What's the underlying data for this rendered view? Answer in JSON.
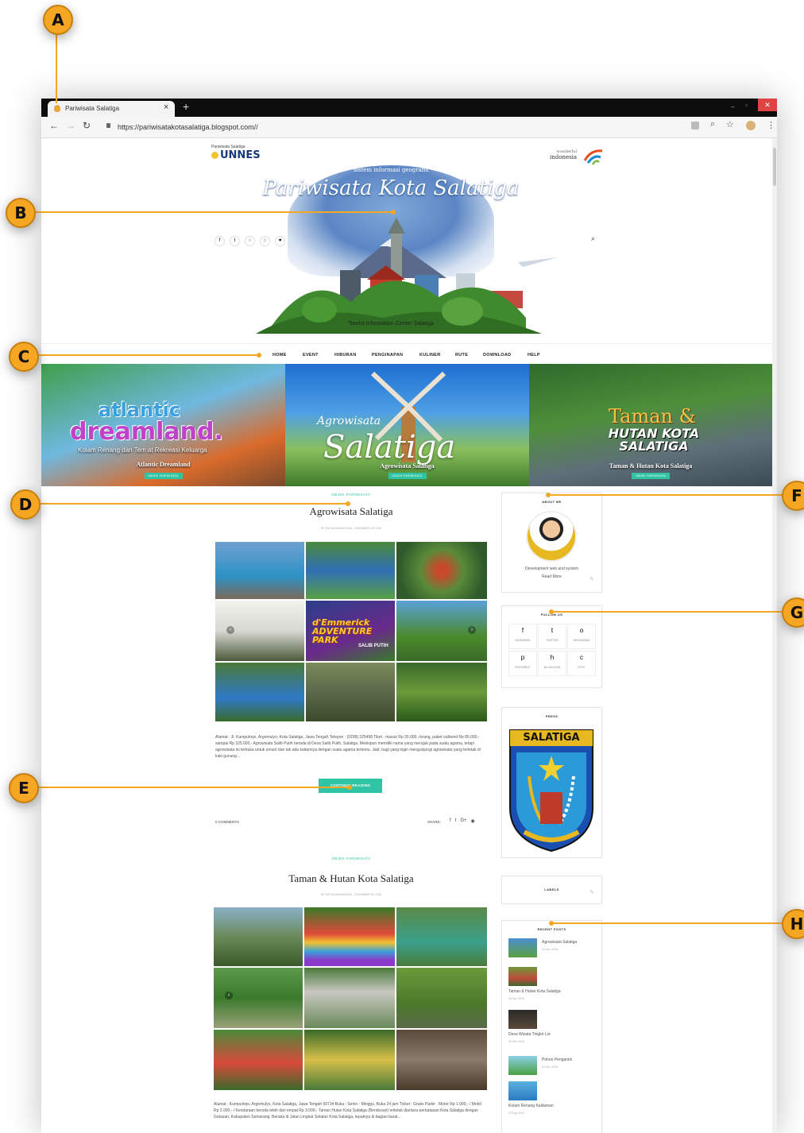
{
  "callouts": {
    "a": "A",
    "b": "B",
    "c": "C",
    "d": "D",
    "e": "E",
    "f": "F",
    "g": "G",
    "h": "H"
  },
  "browser": {
    "tab_title": "Pariwisata Salatiga",
    "tab_close": "×",
    "new_tab": "+",
    "url": "https://pariwisatakotasalatiga.blogspot.com//"
  },
  "header": {
    "logo_small": "Pariwisata Salatiga",
    "logo_big": "UNNES",
    "wi_top": "wonderful",
    "wi_bottom": "indonesia",
    "subtitle": "sistem informasi geografis",
    "title": "Pariwisata Kota Salatiga",
    "footer": "Tourist Information Center Salatiga"
  },
  "nav": [
    "HOME",
    "EVENT",
    "HIBURAN",
    "PENGINAPAN",
    "KULINER",
    "RUTE",
    "DOWNLOAD",
    "HELP"
  ],
  "slides": [
    {
      "art1": "atlantic",
      "art2": "dreamland.",
      "sub": "Kolam Renang dan Tem    at Rekreasi Keluarga",
      "caption": "Atlantic Dreamland",
      "tag": "OBJEK PARIWISATA"
    },
    {
      "art1": "Agrowisata",
      "art2": "Salatiga",
      "caption": "Agrowisata Salatiga",
      "tag": "OBJEK PARIWISATA"
    },
    {
      "art1": "Taman &",
      "art2": "HUTAN KOTA SALATIGA",
      "caption": "Taman & Hutan Kota Salatiga",
      "tag": "OBJEK PARIWISATA"
    }
  ],
  "post1": {
    "category": "OBJEK PARIWISATA",
    "title": "Agrowisata Salatiga",
    "meta": "BY RACHA MAHARDIKA - DESEMBER 05, 2018",
    "collage_text": "d'Emmerick ADVENTURE PARK",
    "collage_text2": "SALIB PUTIH",
    "excerpt": "Alamat : Jl. Kumpulrejo, Argomulyo, Kota Salatiga, Jawa Tengah  Telepon : (0298) 325498 Tiket : masuk Rp 30.000,-/orang, paket outbond Rp 85.000,- sampai Rp 325.000,- Agrowisata Salib Putih berada di Desa Salib Putih, Salatiga. Meskipun memiliki nama yang merujuk pada suatu agama, tetapi agrowisata ini terbuka untuk umum dan tak ada kaitannya dengan suatu agama tertentu. Jadi, bagi yang ingin mengunjungi agrowisata yang terletak di kaki gunung...",
    "button": "CONTINUE READING",
    "comments": "0 COMMENTS",
    "share": "SHARE:"
  },
  "post2": {
    "category": "OBJEK PARIWISATA",
    "title": "Taman & Hutan Kota Salatiga",
    "meta": "BY RACHA MAHARDIKA - DESEMBER 05, 2018",
    "excerpt": "Alamat : Kumpulrejo, Argomulyo, Kota Salatiga, Jawa Tengah 50734 Buka   : Senin - Minggu, Buka 24 jam Ticket   : Gratis Parkir   : Motor Rp 1.000,- / Mobil Rp 2.000,- / Kendaraan beroda lebih dari empat Rp 3.000,- Taman Hutan Kota Salatiga (Bendosari) terletak diantara perbatasan Kota Salatiga dengan Getasan, Kabupaten Semarang. Berada di Jalan Lingkar Selatan Kota Salatiga, tepatnya di bagian barat..."
  },
  "sidebar": {
    "about_title": "ABOUT ME",
    "about_text": "Development web and system",
    "about_link": "Read More",
    "follow_title": "FOLLOW US",
    "follow": [
      {
        "icon": "f",
        "label": "FACEBOOK"
      },
      {
        "icon": "t",
        "label": "TWITTER"
      },
      {
        "icon": "o",
        "label": "INSTAGRAM"
      },
      {
        "icon": "p",
        "label": "PINTEREST"
      },
      {
        "icon": "h",
        "label": "BLOGLOVIN"
      },
      {
        "icon": "c",
        "label": "ETSY"
      }
    ],
    "press_title": "PRESS",
    "press_banner": "SALATIGA",
    "labels_title": "LABELS",
    "recent_title": "RECENT POSTS",
    "recent": [
      {
        "title": "Agrowisata Salatiga",
        "date": "05 Dec 2018"
      },
      {
        "title": "Taman & Hutan Kota Salatiga",
        "date": "05 Dec 2018"
      },
      {
        "title": "Desa Wisata Tingkir Lor",
        "date": "05 Dec 2018"
      },
      {
        "title": "Pohon Pengantin",
        "date": "05 Dec 2018"
      },
      {
        "title": "Kolam Renang Kalitaman",
        "date": "23 Aug 2018"
      }
    ]
  },
  "colors": {
    "accent": "#f5a623",
    "teal": "#2ec4a4",
    "tabbar": "#0d0d0d"
  }
}
